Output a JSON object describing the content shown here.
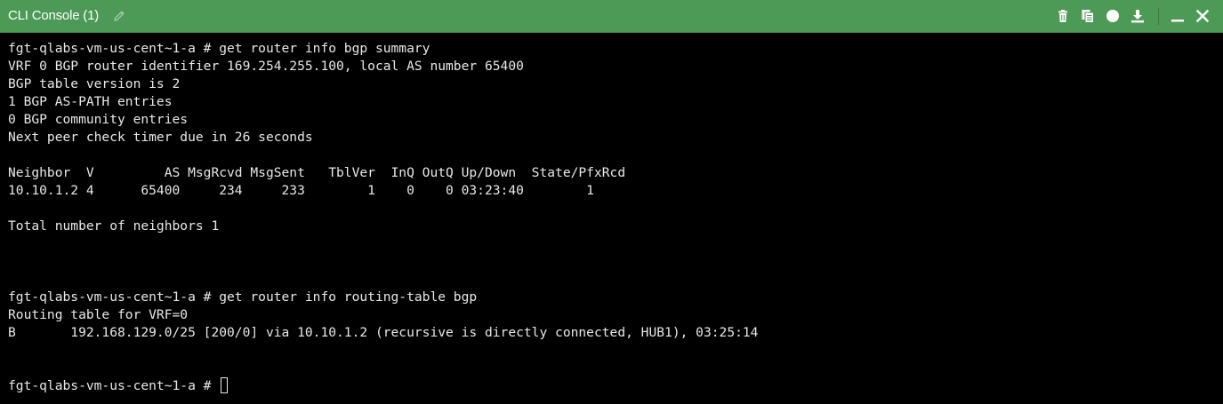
{
  "window": {
    "title": "CLI Console (1)",
    "titlebar_color": "#4d9a57",
    "background": "#000000",
    "text_color": "#e8e8e8"
  },
  "toolbar": {
    "icons": [
      "trash-icon",
      "copy-icon",
      "record-icon",
      "download-icon",
      "minimize-icon",
      "close-icon"
    ]
  },
  "terminal": {
    "lines": [
      "fgt-qlabs-vm-us-cent~1-a # get router info bgp summary",
      "VRF 0 BGP router identifier 169.254.255.100, local AS number 65400",
      "BGP table version is 2",
      "1 BGP AS-PATH entries",
      "0 BGP community entries",
      "Next peer check timer due in 26 seconds",
      "",
      "Neighbor  V         AS MsgRcvd MsgSent   TblVer  InQ OutQ Up/Down  State/PfxRcd",
      "10.10.1.2 4      65400     234     233        1    0    0 03:23:40        1",
      "",
      "Total number of neighbors 1",
      "",
      "",
      "",
      "fgt-qlabs-vm-us-cent~1-a # get router info routing-table bgp",
      "Routing table for VRF=0",
      "B       192.168.129.0/25 [200/0] via 10.10.1.2 (recursive is directly connected, HUB1), 03:25:14",
      "",
      "",
      "fgt-qlabs-vm-us-cent~1-a # "
    ]
  }
}
